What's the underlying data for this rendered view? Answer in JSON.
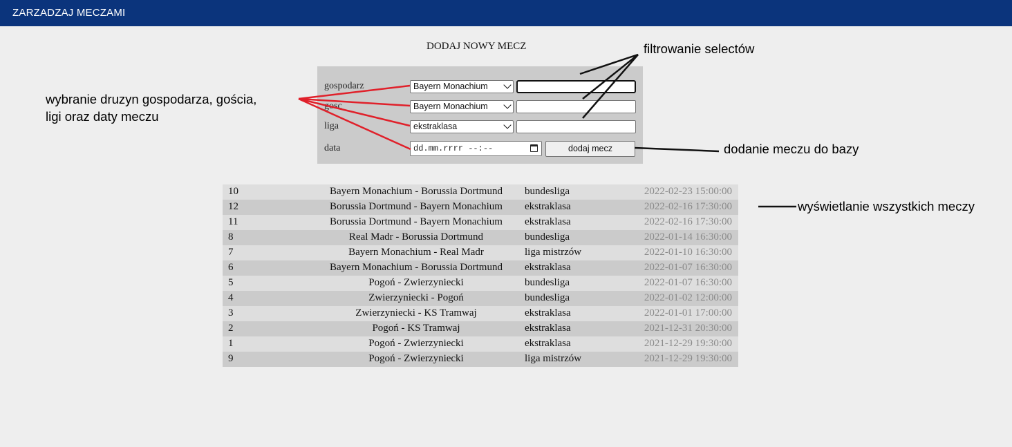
{
  "header": {
    "title": "ZARZADZAJ MECZAMI"
  },
  "form": {
    "title": "DODAJ NOWY MECZ",
    "labels": {
      "home": "gospodarz",
      "guest": "gosc",
      "league": "liga",
      "date": "data"
    },
    "home_select": "Bayern Monachium",
    "guest_select": "Bayern Monachium",
    "league_select": "ekstraklasa",
    "date_placeholder": "dd.mm.rrrr --:--",
    "submit_label": "dodaj mecz"
  },
  "matches": [
    {
      "id": "10",
      "match": "Bayern Monachium - Borussia Dortmund",
      "league": "bundesliga",
      "date": "2022-02-23 15:00:00"
    },
    {
      "id": "12",
      "match": "Borussia Dortmund - Bayern Monachium",
      "league": "ekstraklasa",
      "date": "2022-02-16 17:30:00"
    },
    {
      "id": "11",
      "match": "Borussia Dortmund - Bayern Monachium",
      "league": "ekstraklasa",
      "date": "2022-02-16 17:30:00"
    },
    {
      "id": "8",
      "match": "Real Madr - Borussia Dortmund",
      "league": "bundesliga",
      "date": "2022-01-14 16:30:00"
    },
    {
      "id": "7",
      "match": "Bayern Monachium - Real Madr",
      "league": "liga mistrzów",
      "date": "2022-01-10 16:30:00"
    },
    {
      "id": "6",
      "match": "Bayern Monachium - Borussia Dortmund",
      "league": "ekstraklasa",
      "date": "2022-01-07 16:30:00"
    },
    {
      "id": "5",
      "match": "Pogoń - Zwierzyniecki",
      "league": "bundesliga",
      "date": "2022-01-07 16:30:00"
    },
    {
      "id": "4",
      "match": "Zwierzyniecki - Pogoń",
      "league": "bundesliga",
      "date": "2022-01-02 12:00:00"
    },
    {
      "id": "3",
      "match": "Zwierzyniecki - KS Tramwaj",
      "league": "ekstraklasa",
      "date": "2022-01-01 17:00:00"
    },
    {
      "id": "2",
      "match": "Pogoń - KS Tramwaj",
      "league": "ekstraklasa",
      "date": "2021-12-31 20:30:00"
    },
    {
      "id": "1",
      "match": "Pogoń - Zwierzyniecki",
      "league": "ekstraklasa",
      "date": "2021-12-29 19:30:00"
    },
    {
      "id": "9",
      "match": "Pogoń - Zwierzyniecki",
      "league": "liga mistrzów",
      "date": "2021-12-29 19:30:00"
    }
  ],
  "annotations": {
    "select_teams": "wybranie druzyn gospodarza, gościa,",
    "select_teams_2": "ligi oraz daty meczu",
    "filtering": "filtrowanie selectów",
    "add_to_db": "dodanie meczu do bazy",
    "show_all": "wyświetlanie wszystkich meczy"
  },
  "colors": {
    "header_bg": "#0b347c",
    "annotation_red": "#e0202a"
  }
}
